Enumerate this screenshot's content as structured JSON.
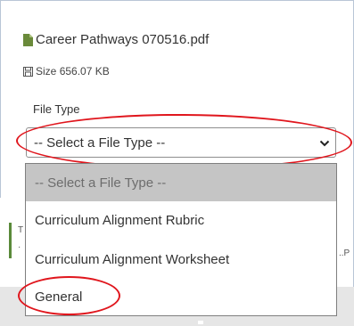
{
  "file": {
    "name": "Career Pathways 070516.pdf",
    "size_label": "Size",
    "size_value": "656.07 KB"
  },
  "file_type": {
    "label": "File Type",
    "selected": "-- Select a File Type --",
    "options": [
      "-- Select a File Type --",
      "Curriculum Alignment Rubric",
      "Curriculum Alignment Worksheet",
      "General"
    ]
  },
  "background": {
    "left_text1": "T",
    "left_text2": "·",
    "right_text": "..P"
  },
  "colors": {
    "annotation": "#e0161d",
    "selected_option_bg": "#c5c5c5",
    "bottom_band": "#e6e6e6"
  }
}
